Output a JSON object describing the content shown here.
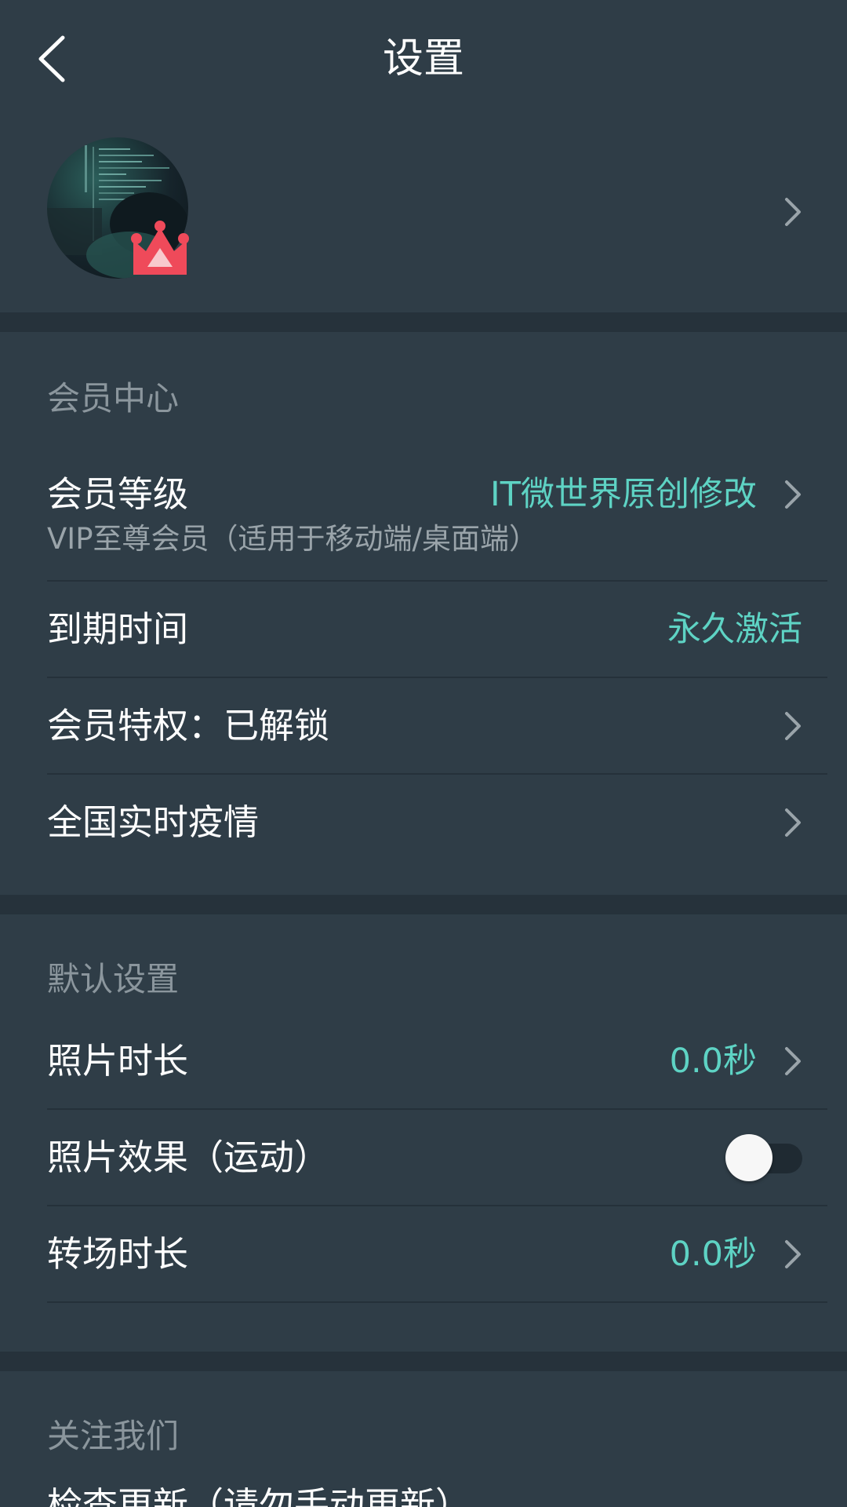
{
  "header": {
    "title": "设置",
    "back_icon": "chevron-left-icon"
  },
  "profile": {
    "avatar_badge_icon": "crown-icon",
    "chevron_icon": "chevron-right-icon"
  },
  "membership": {
    "section_title": "会员中心",
    "level_label": "会员等级",
    "level_sub": "VIP至尊会员（适用于移动端/桌面端）",
    "level_value": "IT微世界原创修改",
    "expiry_label": "到期时间",
    "expiry_value": "永久激活",
    "privileges_label": "会员特权：已解锁",
    "epidemic_label": "全国实时疫情"
  },
  "defaults": {
    "section_title": "默认设置",
    "photo_duration_label": "照片时长",
    "photo_duration_value": "0.0秒",
    "photo_effect_label": "照片效果（运动）",
    "photo_effect_enabled": false,
    "transition_label": "转场时长",
    "transition_value": "0.0秒"
  },
  "follow": {
    "section_title": "关注我们",
    "check_update_label": "检查更新（请勿手动更新）"
  },
  "colors": {
    "background": "#2f3d47",
    "accent": "#5ed3c4",
    "crown": "#ef4a5a"
  }
}
